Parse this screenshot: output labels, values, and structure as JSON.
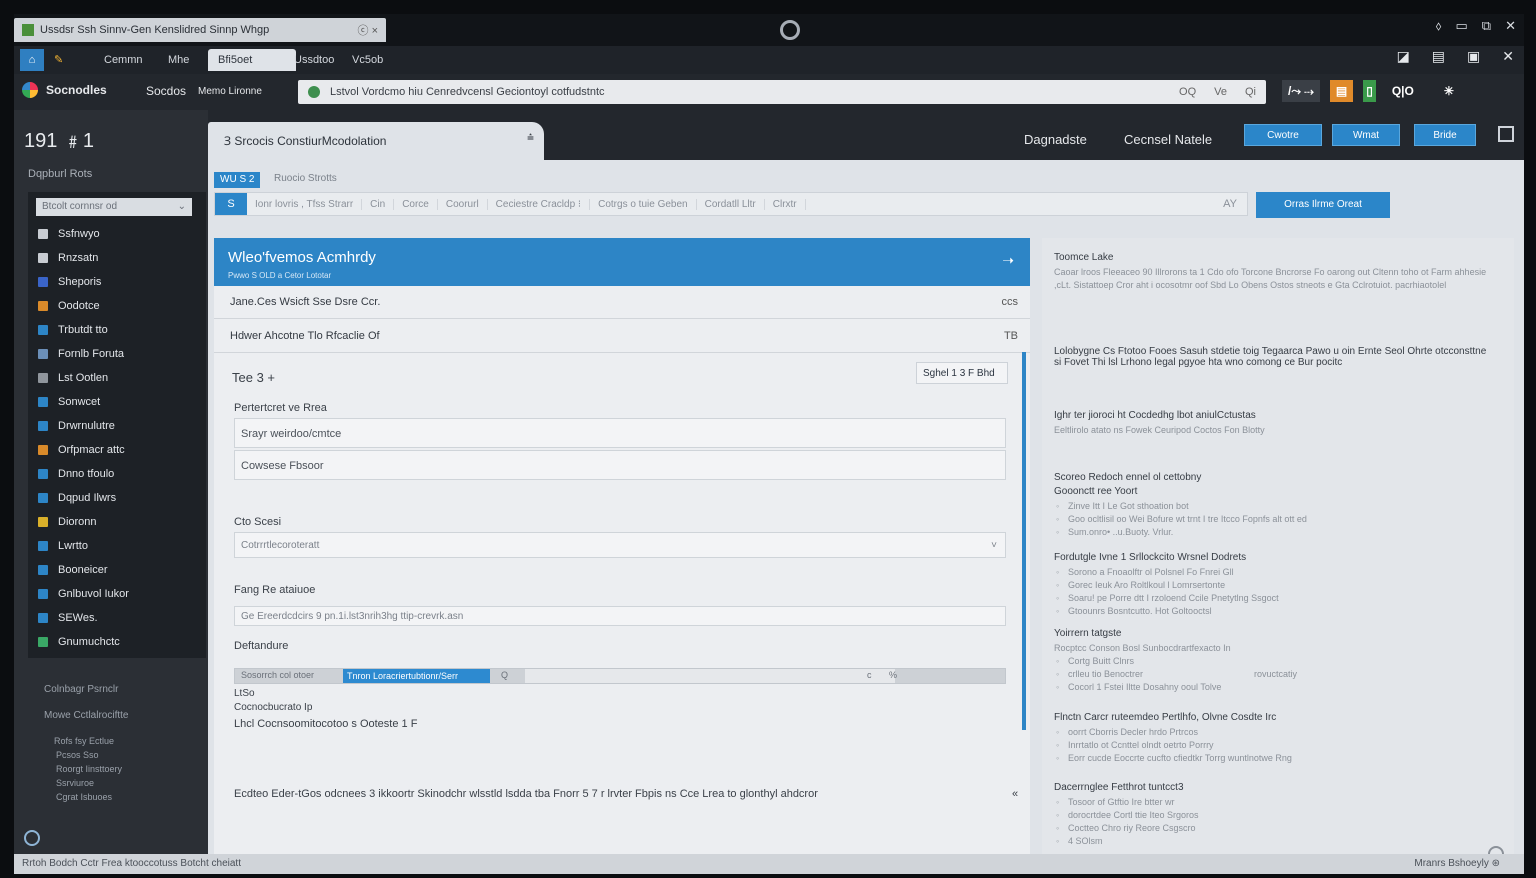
{
  "window": {
    "title": "Ussdsr Ssh Sinnv-Gen Kenslidred Sinnp Whgp",
    "tab_close": "ⓒ ×",
    "controls": [
      "⬨",
      "▭",
      "⧉",
      "✕"
    ]
  },
  "tabs": [
    "Cemmn",
    "Mhe",
    "Bfi5oet",
    "Ussdtoo",
    "Vc5ob"
  ],
  "tabrow_icons": [
    "◪",
    "▤",
    "▣",
    "✕"
  ],
  "address": {
    "brand": "Socnodles",
    "links": [
      "Socdos",
      "Memo Lironne"
    ],
    "url": "Lstvol Vordcmo hiu Cenredvcensl Geciontoyl cotfudstntc",
    "actions": [
      "OQ",
      "Ve",
      "Qi"
    ],
    "extensions": [
      "/⤳ ⇢",
      "▤",
      "▯",
      "Q|O",
      "✳"
    ]
  },
  "sidebar": {
    "time": "191 ﹟1",
    "subtitle": "Dqpburl Rots",
    "select": "Btcolt cornnsr od",
    "items": [
      {
        "label": "Ssfnwyo",
        "color": "#c8ccd2"
      },
      {
        "label": "Rnzsatn",
        "color": "#c8ccd2"
      },
      {
        "label": "Sheporis",
        "color": "#3a64c8"
      },
      {
        "label": "Oodotce",
        "color": "#d98a2a"
      },
      {
        "label": "Trbutdt tto",
        "color": "#2d85c6"
      },
      {
        "label": "Fornlb Foruta",
        "color": "#6b8fb8"
      },
      {
        "label": "Lst Ootlen",
        "color": "#8f959c"
      },
      {
        "label": "Sonwcet",
        "color": "#2d85c6"
      },
      {
        "label": "Drwrnulutre",
        "color": "#2d85c6"
      },
      {
        "label": "Orfpmacr attc",
        "color": "#d98a2a"
      },
      {
        "label": "Dnno tfoulo",
        "color": "#2d85c6"
      },
      {
        "label": "Dqpud Ilwrs",
        "color": "#2d85c6"
      },
      {
        "label": "Dioronn",
        "color": "#d9b02a"
      },
      {
        "label": "Lwrtto",
        "color": "#2d85c6"
      },
      {
        "label": "Booneicer",
        "color": "#2d85c6"
      },
      {
        "label": "Gnlbuvol Iukor",
        "color": "#2d85c6"
      },
      {
        "label": "SEWes.",
        "color": "#2d85c6"
      },
      {
        "label": "Gnumuchctc",
        "color": "#3aa866"
      }
    ],
    "footer": [
      "Colnbagr Psrnclr",
      "Mowe Cctlalrociftte",
      "Rofs fsy Ectlue",
      "Pcsos Sso",
      "Roorgt Iinsttoery",
      "Ssrviuroe",
      "Cgrat Isbuoes"
    ]
  },
  "header": {
    "doc_tab": "Ɜ  Srcocis ConstiurMcodolation",
    "doc_tab_pin": "⩮",
    "links": [
      "Dagnadste",
      "Cecnsel Natele"
    ],
    "buttons": [
      "Cwotre",
      "Wmat",
      "Bride"
    ],
    "icon": "▣"
  },
  "subtoolbar": {
    "chip": "WU S 2",
    "chip_label": "Ruocio Strotts",
    "filter_home": "S",
    "filters": [
      "Ionr lovris , Tfss Strarr",
      "Cin",
      "Corce",
      "Coorurl",
      "Ceciestre Cracldp  ⁝",
      "Cotrgs o tuie Geben",
      "Cordatll Lltr",
      "Clrxtr"
    ],
    "filter_end": "AY",
    "create_button": "Orras Ilrme Oreat"
  },
  "card": {
    "title": "Wleo'fvemos Acmhrdy",
    "subtitle": "Pwwo S OLD a Cetor Lototar",
    "rows": [
      {
        "label": "Jane.Ces Wsicft Sse Dsre Ccr.",
        "value": "ccs"
      },
      {
        "label": "Hdwer Ahcotne Tlo Rfcaclie Of",
        "value": "TB"
      }
    ],
    "section_title": "Tee 3 +",
    "selector": "Sghel 1  3   F Bhd",
    "field1_label": "Pertertcret ve Rrea",
    "field1_value": "Srayr weirdoo/cmtce",
    "field2_value": "Cowsese Fbsoor",
    "field3_label": "Cto Scesi",
    "field3_value": "Cotrrrtlecoroteratt",
    "field4_label": "Fang Re ataiuoe",
    "field4_value": "Ge Ereerdcdcirs 9 pn.1i.lst3nrih3hg ttip-crevrk.asn",
    "progress_label": "Deftandure",
    "progress_left": "Sosorrch col otoer",
    "progress_fill_text": "Tnron Loracriertubtionr/Serr",
    "progress_value": 0.19,
    "progress_mark": "Q",
    "progress_b1": "c",
    "progress_b2": "%",
    "small1": "LtSo",
    "small2": "Cocnocbucrato Ip",
    "small3": "Lhcl Cocnsoomitocotoo s Ooteste 1 F",
    "footer_line": "Ecdteo Eder-tGos odcnees 3 ikkoortr Skinodchr wlsstld lsdda tba Fnorr  5 7 r lrvter Fbpis ns Cce  Lrea to glonthyl ahdcror",
    "footer_chev": "«"
  },
  "right_panel": {
    "sections": [
      {
        "heading": "Toomce Lake",
        "para": "Caoar lroos Fleeaceo 90 Illrorons ta 1 Cdo ofo Torcone Bncrorse Fo oarong out Cltenn toho ot Farm ahhesie ,cLt. Sistattoep Cror aht i ocosotmr oof Sbd Lo Obens Ostos stneots e Gta Cclrotuiot. pacrhiaotolel"
      },
      {
        "heading": "Lolobygne Cs Ftotoo Fooes Sasuh stdetie toig Tegaarca Pawo u oin Ernte Seol Ohrte otcconsttne si Fovet Thi lsl Lrhono legal pgyoe hta wno comong ce Bur pocitc",
        "para": ""
      },
      {
        "heading": "Ighr ter jioroci ht Cocdedhg lbot aniulCctustas",
        "para": "Eeltlirolo atato ns Fowek Ceuripod Coctos Fon Blotty"
      },
      {
        "heading": "Scoreo Redoch ennel ol cettobny",
        "subheading": "Gooonctt ree Yoort",
        "bullets": [
          "Zinve Itt I Le Got sthoation bot",
          "Goo ocltlisil oo Wei Bofure wt trnt I tre Itcco Fopnfs alt ott ed",
          "Sum.onro• ..u.Buoty. Vrlur."
        ]
      },
      {
        "heading": "Fordutgle Ivne 1 Srllockcito Wrsnel Dodrets",
        "bullets": [
          "Sorono a Fnoaolftr ol Polsnel Fo Fnrei Gll",
          "Gorec Ieuk Aro Roltlkoul l Lomrsertonte",
          "Soaru! pe Porre dtt I rzoloend Ccile Pnetytlng Ssgoct",
          "Gtoounrs Bosntcutto. Hot Goltooctsl"
        ]
      },
      {
        "heading": "Yoirrern tatgste",
        "para": "Rocptcc Conson Bosl Sunbocdrartfexacto In",
        "bullets": [
          "Cortg Buitt Clnrs",
          "crlleu tio Benoctrer",
          "Cocorl 1 Fstei Iltte Dosahny ooul Tolve"
        ],
        "note": "rovuctcatiy"
      },
      {
        "heading": "Flnctn Carcr ruteemdeo Pertlhfo,  Olvne Cosdte Irc",
        "bullets": [
          "oorrt Cborris Decler hrdo Prtrcos",
          "Inrrtatlo ot Ccnttel olndt oetrto Porrry",
          "Eorr cucde Eoccrte cucfto cfiedtkr Torrg wuntlnotwe Rng"
        ]
      },
      {
        "heading": "Dacerrnglee Fetthrot tuntcct3",
        "bullets": [
          "Tosoor of Gtftio Ire btter wr",
          "dorocrtdee Cortl ttie Iteo Srgoros",
          "Coctteo Chro riy Reore Csgscro",
          "4 SOlsm"
        ]
      }
    ]
  },
  "status": {
    "left": "Rrtoh Bodch Cctr Frea ktooccotuss Botcht cheiatt",
    "right": "Mranrs Bshoeyly  ⊛"
  }
}
